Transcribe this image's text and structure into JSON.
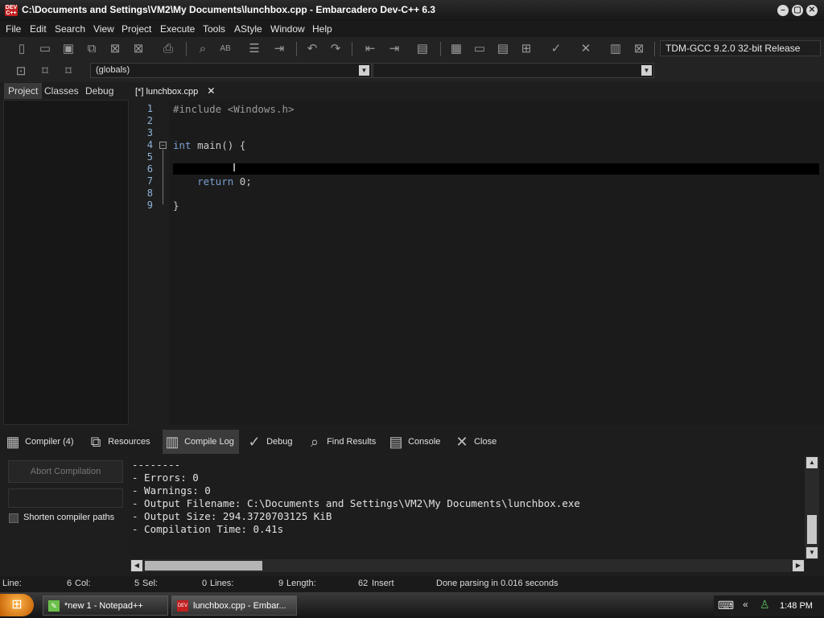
{
  "window": {
    "title": "C:\\Documents and Settings\\VM2\\My Documents\\lunchbox.cpp - Embarcadero Dev-C++ 6.3",
    "app_icon_text": "DEV C++"
  },
  "menu": [
    "File",
    "Edit",
    "Search",
    "View",
    "Project",
    "Execute",
    "Tools",
    "AStyle",
    "Window",
    "Help"
  ],
  "toolbar": {
    "compiler": "TDM-GCC 9.2.0 32-bit Release",
    "scope_combo": "(globals)",
    "function_combo": ""
  },
  "left_tabs": [
    "Project",
    "Classes",
    "Debug"
  ],
  "editor": {
    "tab_label": "[*] lunchbox.cpp",
    "line_numbers": [
      "1",
      "2",
      "3",
      "4",
      "5",
      "6",
      "7",
      "8",
      "9"
    ],
    "lines": [
      "#include <Windows.h>",
      "",
      "",
      "int main() {",
      "",
      "",
      "    return 0;",
      "",
      "}"
    ]
  },
  "bottom_tabs": [
    "Compiler (4)",
    "Resources",
    "Compile Log",
    "Debug",
    "Find Results",
    "Console",
    "Close"
  ],
  "compile_panel": {
    "abort_label": "Abort Compilation",
    "shorten_label": "Shorten compiler paths",
    "log": [
      "--------",
      "- Errors: 0",
      "- Warnings: 0",
      "- Output Filename: C:\\Documents and Settings\\VM2\\My Documents\\lunchbox.exe",
      "- Output Size: 294.3720703125 KiB",
      "- Compilation Time: 0.41s"
    ]
  },
  "status": {
    "line_label": "Line:",
    "line_value": "6",
    "col_label": "Col:",
    "col_value": "5",
    "sel_label": "Sel:",
    "sel_value": "0",
    "lines_label": "Lines:",
    "lines_value": "9",
    "length_label": "Length:",
    "length_value": "62",
    "mode": "Insert",
    "message": "Done parsing in 0.016 seconds"
  },
  "taskbar": {
    "tasks": [
      "*new 1 - Notepad++",
      "lunchbox.cpp - Embar..."
    ],
    "clock": "1:48 PM"
  },
  "colors": {
    "background": "#1e1e1e",
    "line_number": "#8fb3d8",
    "keyword": "#7a9fd0"
  }
}
